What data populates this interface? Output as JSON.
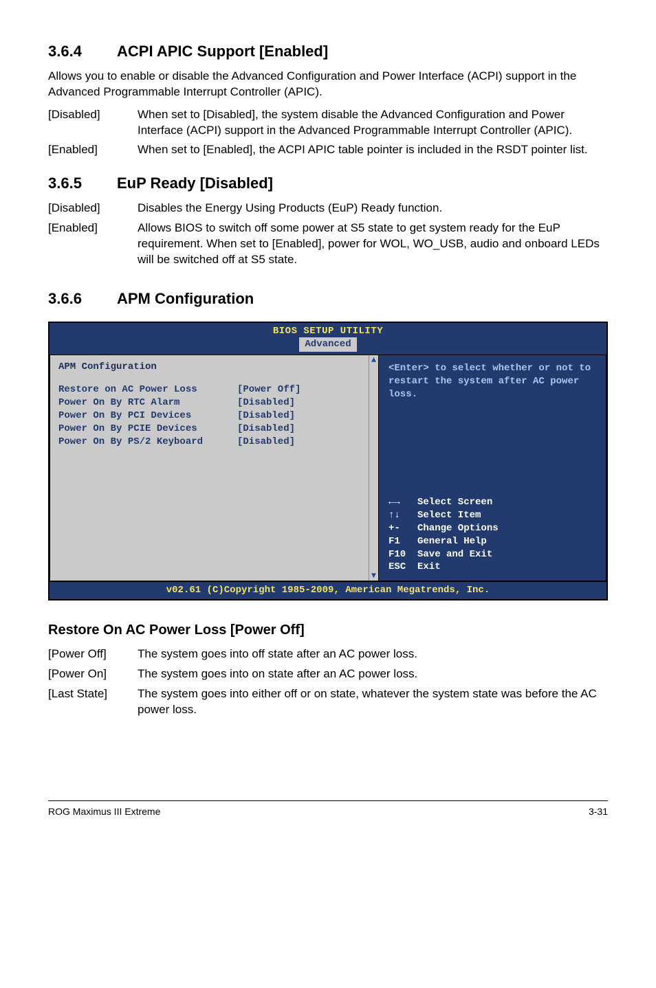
{
  "s364": {
    "num": "3.6.4",
    "title": "ACPI APIC Support [Enabled]",
    "intro": "Allows you to enable or disable the Advanced Configuration and Power Interface (ACPI) support in the Advanced Programmable Interrupt Controller (APIC).",
    "rows": [
      {
        "k": "[Disabled]",
        "v": "When set to [Disabled], the system disable the Advanced Configuration and Power Interface (ACPI) support in the Advanced Programmable Interrupt Controller (APIC)."
      },
      {
        "k": "[Enabled]",
        "v": "When set to [Enabled], the ACPI APIC table pointer is included in the RSDT pointer list."
      }
    ]
  },
  "s365": {
    "num": "3.6.5",
    "title": "EuP Ready [Disabled]",
    "rows": [
      {
        "k": "[Disabled]",
        "v": "Disables the Energy Using Products (EuP) Ready function."
      },
      {
        "k": "[Enabled]",
        "v": "Allows BIOS to switch off some power at S5 state to get system ready for the EuP requirement. When set to [Enabled], power for WOL, WO_USB, audio and onboard LEDs will be switched off at S5 state."
      }
    ]
  },
  "s366": {
    "num": "3.6.6",
    "title": "APM Configuration"
  },
  "bios": {
    "title": "BIOS SETUP UTILITY",
    "tab": "Advanced",
    "panel_title": "APM Configuration",
    "items": [
      {
        "k": "Restore on AC Power Loss",
        "v": "[Power Off]"
      },
      {
        "k": "Power On By RTC Alarm",
        "v": "[Disabled]"
      },
      {
        "k": "Power On By PCI Devices",
        "v": "[Disabled]"
      },
      {
        "k": "Power On By PCIE Devices",
        "v": "[Disabled]"
      },
      {
        "k": "Power On By PS/2 Keyboard",
        "v": "[Disabled]"
      }
    ],
    "help_top": "<Enter> to select whether or not to restart the system after AC power loss.",
    "help_keys": [
      {
        "key": "←→",
        "label": "Select Screen"
      },
      {
        "key": "↑↓",
        "label": "Select Item"
      },
      {
        "key": "+-",
        "label": "Change Options"
      },
      {
        "key": "F1",
        "label": "General Help"
      },
      {
        "key": "F10",
        "label": "Save and Exit"
      },
      {
        "key": "ESC",
        "label": "Exit"
      }
    ],
    "footer": "v02.61 (C)Copyright 1985-2009, American Megatrends, Inc."
  },
  "restore": {
    "heading": "Restore On AC Power Loss [Power Off]",
    "rows": [
      {
        "k": "[Power Off]",
        "v": "The system goes into off state after an AC power loss."
      },
      {
        "k": "[Power On]",
        "v": "The system goes into on state after an AC power loss."
      },
      {
        "k": "[Last State]",
        "v": "The system goes into either off or on state, whatever the system state was before the AC power loss."
      }
    ]
  },
  "footer": {
    "left": "ROG Maximus III Extreme",
    "right": "3-31"
  }
}
